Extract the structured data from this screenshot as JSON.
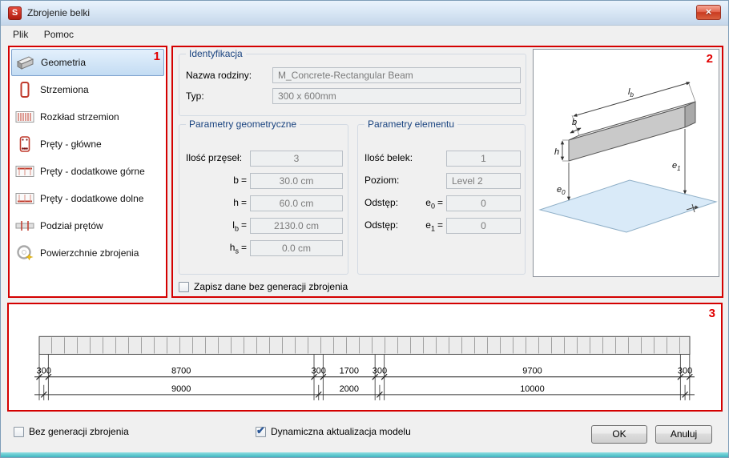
{
  "window": {
    "title": "Zbrojenie belki",
    "icon_letter": "S",
    "close_glyph": "×"
  },
  "menu": {
    "items": [
      {
        "label": "Plik"
      },
      {
        "label": "Pomoc"
      }
    ]
  },
  "annotations": {
    "panel1": "1",
    "panel2": "2",
    "panel3": "3"
  },
  "icons": {
    "checkmark": "✔"
  },
  "sidebar": {
    "items": [
      {
        "label": "Geometria"
      },
      {
        "label": "Strzemiona"
      },
      {
        "label": "Rozkład strzemion"
      },
      {
        "label": "Pręty - główne"
      },
      {
        "label": "Pręty - dodatkowe górne"
      },
      {
        "label": "Pręty - dodatkowe dolne"
      },
      {
        "label": "Podział prętów"
      },
      {
        "label": "Powierzchnie zbrojenia"
      }
    ]
  },
  "identification": {
    "title": "Identyfikacja",
    "family_label": "Nazwa rodziny:",
    "family_value": "M_Concrete-Rectangular Beam",
    "type_label": "Typ:",
    "type_value": "300 x 600mm"
  },
  "geometry_params": {
    "title": "Parametry geometryczne",
    "spans_label": "Ilość przęseł:",
    "spans_value": "3",
    "rows": [
      {
        "main": "b",
        "sub": "",
        "eq": "=",
        "value": "30.0 cm"
      },
      {
        "main": "h",
        "sub": "",
        "eq": "=",
        "value": "60.0 cm"
      },
      {
        "main": "l",
        "sub": "b",
        "eq": "=",
        "value": "2130.0 cm"
      },
      {
        "main": "h",
        "sub": "s",
        "eq": "=",
        "value": "0.0 cm"
      }
    ]
  },
  "element_params": {
    "title": "Parametry elementu",
    "beams_label": "Ilość belek:",
    "beams_value": "1",
    "level_label": "Poziom:",
    "level_value": "Level 2",
    "offset_label": "Odstęp:",
    "e0": {
      "main": "e",
      "sub": "0",
      "eq": "=",
      "value": "0"
    },
    "e1": {
      "main": "e",
      "sub": "1",
      "eq": "=",
      "value": "0"
    }
  },
  "save_checkbox": {
    "label": "Zapisz dane bez generacji zbrojenia",
    "checked": false
  },
  "preview": {
    "labels": {
      "lb_main": "l",
      "lb_sub": "b",
      "b": "b",
      "h": "h",
      "e0_main": "e",
      "e0_sub": "0",
      "e1_main": "e",
      "e1_sub": "1"
    }
  },
  "elevation": {
    "dims_top": [
      "300",
      "8700",
      "300",
      "1700",
      "300",
      "9700",
      "300"
    ],
    "dims_bottom": [
      "9000",
      "2000",
      "10000"
    ]
  },
  "footer": {
    "no_reinforcement": {
      "label": "Bez generacji zbrojenia",
      "checked": false
    },
    "dynamic_update": {
      "label": "Dynamiczna aktualizacja modelu",
      "checked": true
    },
    "ok_label": "OK",
    "cancel_label": "Anuluj"
  }
}
